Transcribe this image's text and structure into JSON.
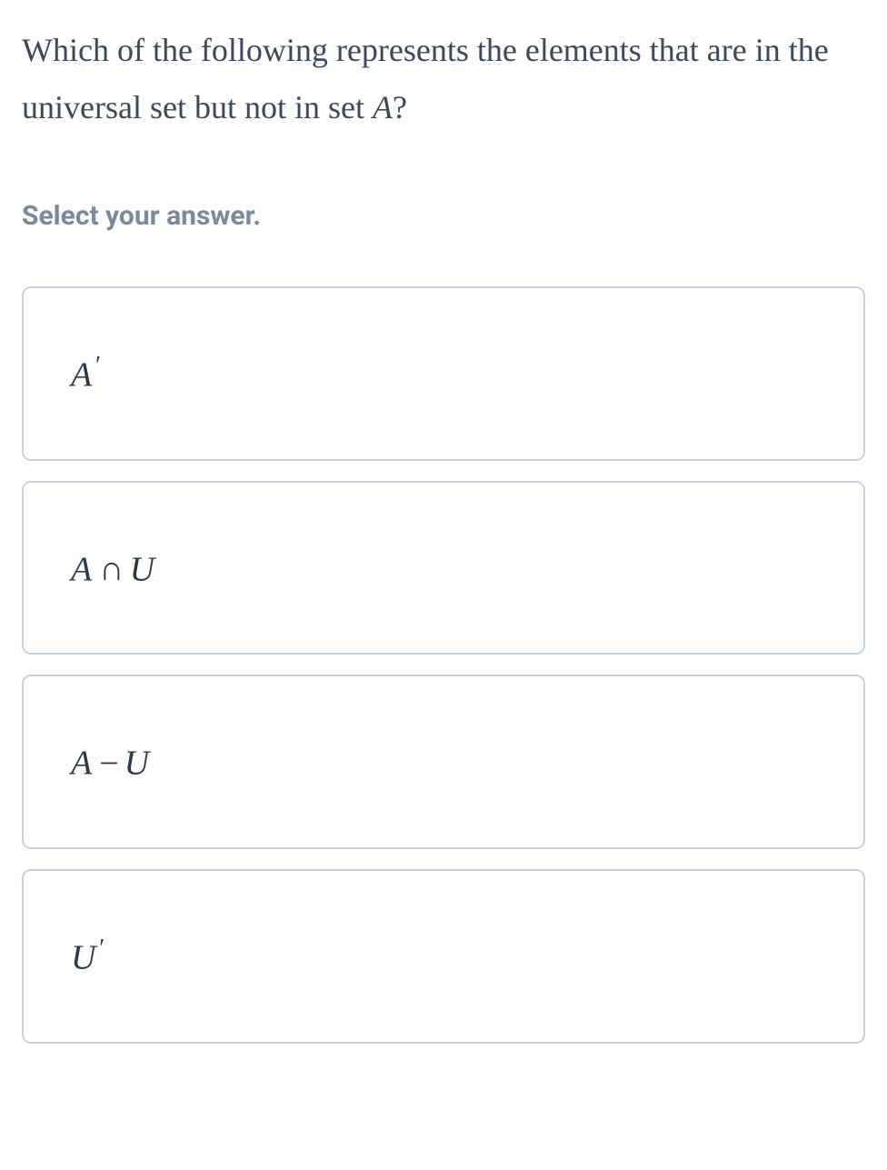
{
  "question": {
    "prefix": "Which of the following represents the elements that are in the universal set but not in set ",
    "mathVar": "A",
    "suffix": "?"
  },
  "instruction": "Select your answer.",
  "options": [
    {
      "var1": "A",
      "prime1": "′",
      "op": "",
      "var2": "",
      "prime2": ""
    },
    {
      "var1": "A",
      "prime1": "",
      "op": "∩",
      "var2": "U",
      "prime2": ""
    },
    {
      "var1": "A",
      "prime1": "",
      "op": "−",
      "var2": "U",
      "prime2": ""
    },
    {
      "var1": "U",
      "prime1": "′",
      "op": "",
      "var2": "",
      "prime2": ""
    }
  ]
}
